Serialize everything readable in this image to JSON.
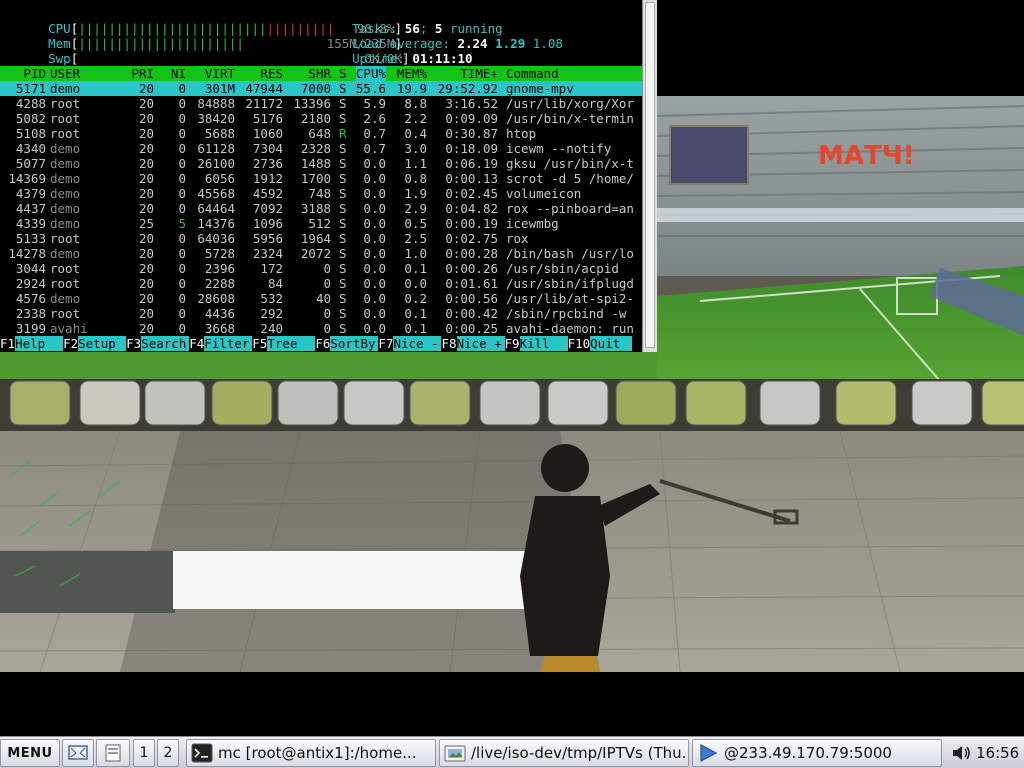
{
  "htop": {
    "meters": {
      "cpu_label": "CPU",
      "cpu_value": "90.8%",
      "mem_label": "Mem",
      "mem_value": "155M/235M",
      "swp_label": "Swp",
      "swp_value": "0K/0K",
      "cpu_fraction": 0.908,
      "mem_fraction": 0.66,
      "swp_fraction": 0.0
    },
    "summary": {
      "tasks_label": "Tasks:",
      "tasks_count": "56",
      "running_count": "5",
      "running_label": "running",
      "load_label": "Load average:",
      "load_1": "2.24",
      "load_5": "1.29",
      "load_15": "1.08",
      "uptime_label": "Uptime:",
      "uptime_value": "01:11:10"
    },
    "columns": [
      "PID",
      "USER",
      "PRI",
      "NI",
      "VIRT",
      "RES",
      "SHR",
      "S",
      "CPU%",
      "MEM%",
      "TIME+",
      "Command"
    ],
    "processes": [
      {
        "pid": "5171",
        "user": "demo",
        "pri": "20",
        "ni": "0",
        "virt": "301M",
        "res": "47944",
        "shr": "7000",
        "s": "S",
        "cpu": "55.6",
        "mem": "19.9",
        "time": "29:52.92",
        "cmd": "gnome-mpv",
        "selected": true
      },
      {
        "pid": "4288",
        "user": "root",
        "pri": "20",
        "ni": "0",
        "virt": "84888",
        "res": "21172",
        "shr": "13396",
        "s": "S",
        "cpu": "5.9",
        "mem": "8.8",
        "time": "3:16.52",
        "cmd": "/usr/lib/xorg/Xor"
      },
      {
        "pid": "5082",
        "user": "root",
        "pri": "20",
        "ni": "0",
        "virt": "38420",
        "res": "5176",
        "shr": "2180",
        "s": "S",
        "cpu": "2.6",
        "mem": "2.2",
        "time": "0:09.09",
        "cmd": "/usr/bin/x-termin"
      },
      {
        "pid": "5108",
        "user": "root",
        "pri": "20",
        "ni": "0",
        "virt": "5688",
        "res": "1060",
        "shr": "648",
        "s": "R",
        "cpu": "0.7",
        "mem": "0.4",
        "time": "0:30.87",
        "cmd": "htop"
      },
      {
        "pid": "4340",
        "user": "demo",
        "pri": "20",
        "ni": "0",
        "virt": "61128",
        "res": "7304",
        "shr": "2328",
        "s": "S",
        "cpu": "0.7",
        "mem": "3.0",
        "time": "0:18.09",
        "cmd": "icewm --notify"
      },
      {
        "pid": "5077",
        "user": "demo",
        "pri": "20",
        "ni": "0",
        "virt": "26100",
        "res": "2736",
        "shr": "1488",
        "s": "S",
        "cpu": "0.0",
        "mem": "1.1",
        "time": "0:06.19",
        "cmd": "gksu /usr/bin/x-t"
      },
      {
        "pid": "14369",
        "user": "demo",
        "pri": "20",
        "ni": "0",
        "virt": "6056",
        "res": "1912",
        "shr": "1700",
        "s": "S",
        "cpu": "0.0",
        "mem": "0.8",
        "time": "0:00.13",
        "cmd": "scrot -d 5 /home/"
      },
      {
        "pid": "4379",
        "user": "demo",
        "pri": "20",
        "ni": "0",
        "virt": "45568",
        "res": "4592",
        "shr": "748",
        "s": "S",
        "cpu": "0.0",
        "mem": "1.9",
        "time": "0:02.45",
        "cmd": "volumeicon"
      },
      {
        "pid": "4437",
        "user": "demo",
        "pri": "20",
        "ni": "0",
        "virt": "64464",
        "res": "7092",
        "shr": "3188",
        "s": "S",
        "cpu": "0.0",
        "mem": "2.9",
        "time": "0:04.82",
        "cmd": "rox --pinboard=an"
      },
      {
        "pid": "4339",
        "user": "demo",
        "pri": "25",
        "ni": "5",
        "virt": "14376",
        "res": "1096",
        "shr": "512",
        "s": "S",
        "cpu": "0.0",
        "mem": "0.5",
        "time": "0:00.19",
        "cmd": "icewmbg"
      },
      {
        "pid": "5133",
        "user": "root",
        "pri": "20",
        "ni": "0",
        "virt": "64036",
        "res": "5956",
        "shr": "1964",
        "s": "S",
        "cpu": "0.0",
        "mem": "2.5",
        "time": "0:02.75",
        "cmd": "rox"
      },
      {
        "pid": "14278",
        "user": "demo",
        "pri": "20",
        "ni": "0",
        "virt": "5728",
        "res": "2324",
        "shr": "2072",
        "s": "S",
        "cpu": "0.0",
        "mem": "1.0",
        "time": "0:00.28",
        "cmd": "/bin/bash /usr/lo"
      },
      {
        "pid": "3044",
        "user": "root",
        "pri": "20",
        "ni": "0",
        "virt": "2396",
        "res": "172",
        "shr": "0",
        "s": "S",
        "cpu": "0.0",
        "mem": "0.1",
        "time": "0:00.26",
        "cmd": "/usr/sbin/acpid"
      },
      {
        "pid": "2924",
        "user": "root",
        "pri": "20",
        "ni": "0",
        "virt": "2288",
        "res": "84",
        "shr": "0",
        "s": "S",
        "cpu": "0.0",
        "mem": "0.0",
        "time": "0:01.61",
        "cmd": "/usr/sbin/ifplugd"
      },
      {
        "pid": "4576",
        "user": "demo",
        "pri": "20",
        "ni": "0",
        "virt": "28608",
        "res": "532",
        "shr": "40",
        "s": "S",
        "cpu": "0.0",
        "mem": "0.2",
        "time": "0:00.56",
        "cmd": "/usr/lib/at-spi2-"
      },
      {
        "pid": "2338",
        "user": "root",
        "pri": "20",
        "ni": "0",
        "virt": "4436",
        "res": "292",
        "shr": "0",
        "s": "S",
        "cpu": "0.0",
        "mem": "0.1",
        "time": "0:00.42",
        "cmd": "/sbin/rpcbind -w"
      },
      {
        "pid": "3199",
        "user": "avahi",
        "pri": "20",
        "ni": "0",
        "virt": "3668",
        "res": "240",
        "shr": "0",
        "s": "S",
        "cpu": "0.0",
        "mem": "0.1",
        "time": "0:00.25",
        "cmd": "avahi-daemon: run"
      }
    ],
    "function_keys": [
      {
        "key": "F1",
        "label": "Help"
      },
      {
        "key": "F2",
        "label": "Setup"
      },
      {
        "key": "F3",
        "label": "Search"
      },
      {
        "key": "F4",
        "label": "Filter"
      },
      {
        "key": "F5",
        "label": "Tree"
      },
      {
        "key": "F6",
        "label": "SortBy"
      },
      {
        "key": "F7",
        "label": "Nice -"
      },
      {
        "key": "F8",
        "label": "Nice +"
      },
      {
        "key": "F9",
        "label": "Kill"
      },
      {
        "key": "F10",
        "label": "Quit"
      }
    ]
  },
  "video": {
    "channel_logo": "МАТЧ!"
  },
  "taskbar": {
    "menu_label": "MENU",
    "workspaces": [
      "1",
      "2"
    ],
    "tasks": [
      {
        "title": "mc [root@antix1]:/home...",
        "icon": "terminal-icon"
      },
      {
        "title": "/live/iso-dev/tmp/IPTVs (Thu...",
        "icon": "file-manager-icon"
      },
      {
        "title": "@233.49.170.79:5000",
        "icon": "media-player-icon"
      }
    ],
    "clock": "16:56"
  }
}
